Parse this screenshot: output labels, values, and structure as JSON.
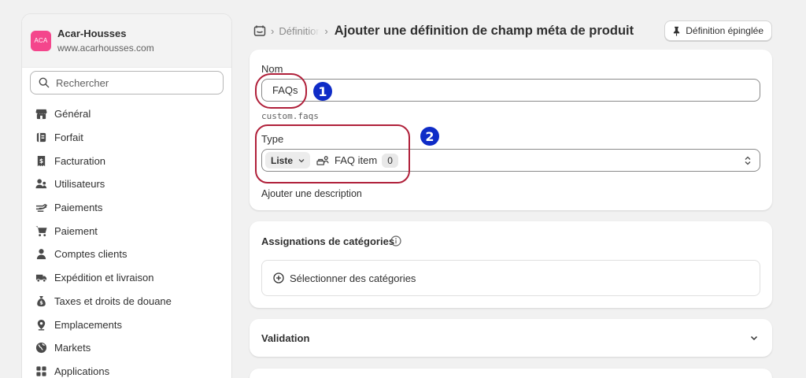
{
  "store": {
    "logo_text": "ACA",
    "name": "Acar-Housses",
    "url": "www.acarhousses.com",
    "logo_color": "#f4468c"
  },
  "search": {
    "placeholder": "Rechercher"
  },
  "sidebar": {
    "items": [
      {
        "label": "Général",
        "icon": "store-icon"
      },
      {
        "label": "Forfait",
        "icon": "plan-icon"
      },
      {
        "label": "Facturation",
        "icon": "receipt-icon"
      },
      {
        "label": "Utilisateurs",
        "icon": "users-icon"
      },
      {
        "label": "Paiements",
        "icon": "hand-money-icon"
      },
      {
        "label": "Paiement",
        "icon": "cart-icon"
      },
      {
        "label": "Comptes clients",
        "icon": "person-icon"
      },
      {
        "label": "Expédition et livraison",
        "icon": "truck-icon"
      },
      {
        "label": "Taxes et droits de douane",
        "icon": "money-bag-icon"
      },
      {
        "label": "Emplacements",
        "icon": "location-pin-icon"
      },
      {
        "label": "Markets",
        "icon": "globe-icon"
      },
      {
        "label": "Applications",
        "icon": "apps-icon"
      }
    ]
  },
  "header": {
    "breadcrumb": "Définitions",
    "separator": "›",
    "title": "Ajouter une définition de champ méta de produit",
    "pin_button": "Définition épinglée"
  },
  "form": {
    "name_label": "Nom",
    "name_value": "FAQs",
    "key": "custom.faqs",
    "type_label": "Type",
    "type_list": "Liste",
    "type_reference": "FAQ item",
    "type_count": "0",
    "add_description": "Ajouter une description"
  },
  "categories": {
    "title": "Assignations de catégories",
    "select_button": "Sélectionner des catégories"
  },
  "validation": {
    "title": "Validation"
  },
  "annotations": {
    "one": "1",
    "two": "2",
    "ring_color": "#b0203a",
    "badge_color": "#0f2cc7"
  }
}
